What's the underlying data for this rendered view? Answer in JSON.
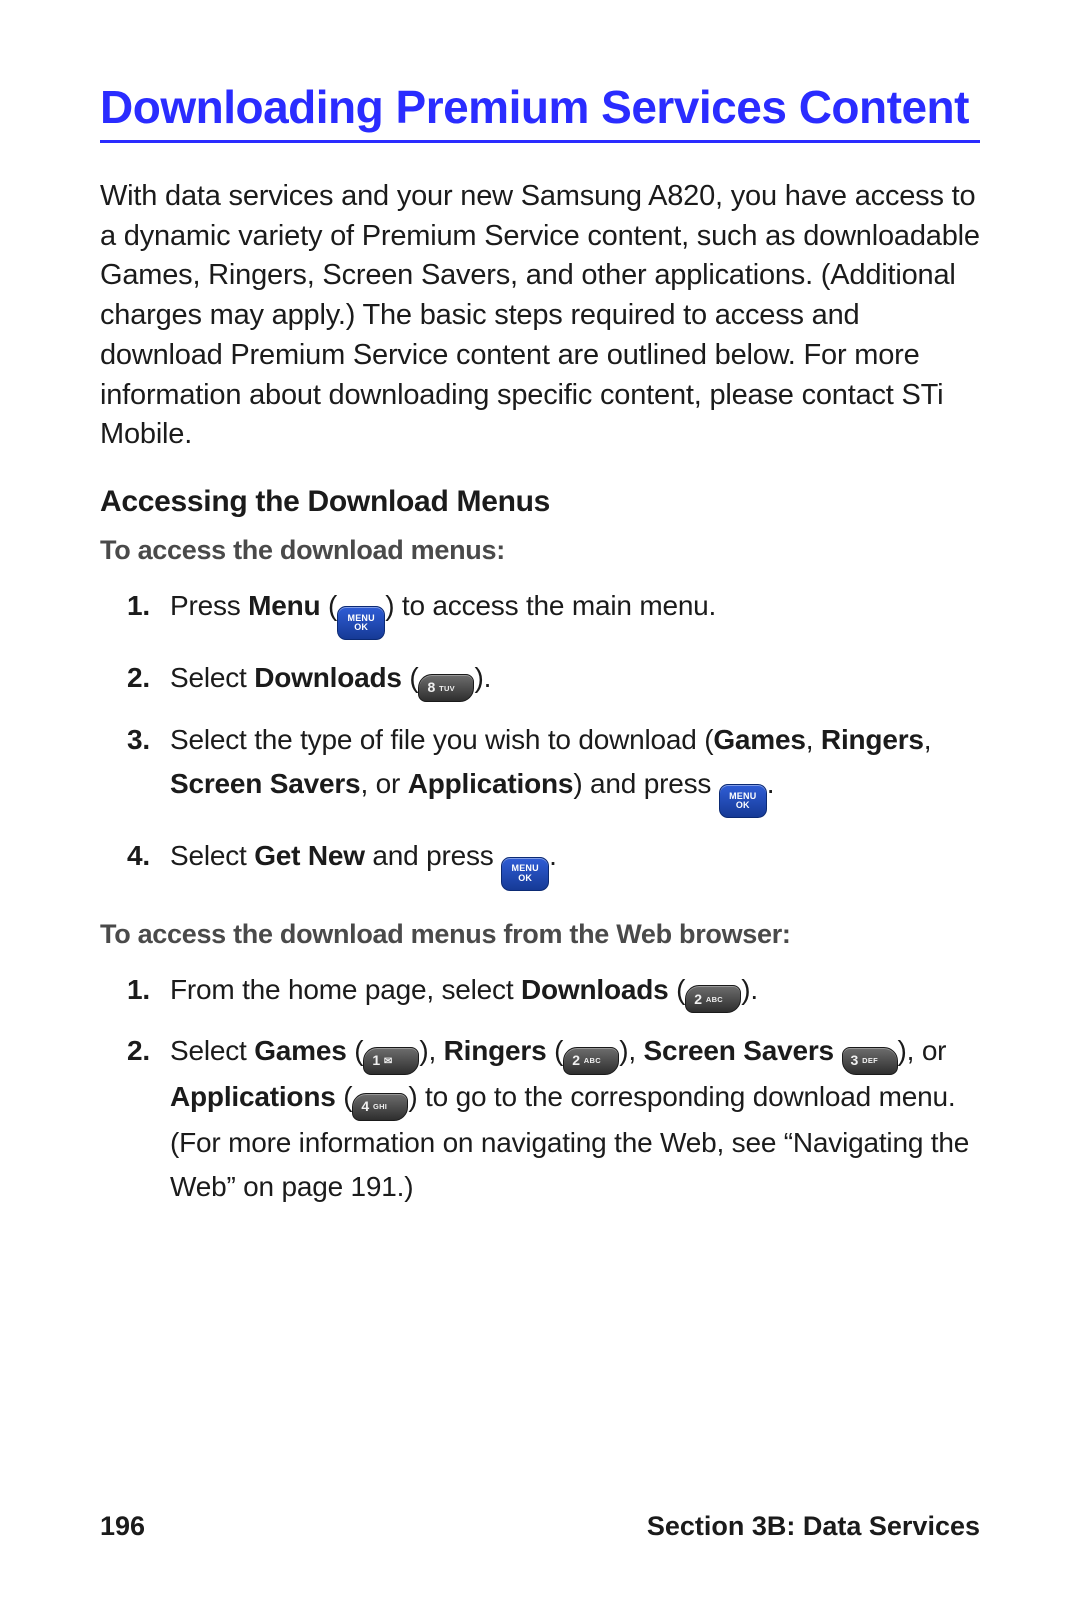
{
  "title": "Downloading Premium Services Content",
  "intro": "With data services and your new Samsung A820, you have access to a dynamic variety of Premium Service content, such as downloadable Games, Ringers, Screen Savers, and other applications. (Additional charges may apply.) The basic steps required to access and download Premium Service content are outlined below. For more information about downloading specific content, please contact STi Mobile.",
  "subhead": "Accessing the Download Menus",
  "instr1": "To access the download menus:",
  "steps1": {
    "n1": "1.",
    "s1a": "Press ",
    "s1b": "Menu",
    "s1c": " (",
    "s1d": ") to access the main menu.",
    "n2": "2.",
    "s2a": "Select ",
    "s2b": "Downloads",
    "s2c": " (",
    "s2d": ").",
    "n3": "3.",
    "s3a": "Select the type of file you wish to download (",
    "s3b": "Games",
    "s3c": ", ",
    "s3d": "Ringers",
    "s3e": ", ",
    "s3f": "Screen Savers",
    "s3g": ", or ",
    "s3h": "Applications",
    "s3i": ") and press ",
    "s3j": ".",
    "n4": "4.",
    "s4a": "Select ",
    "s4b": "Get New",
    "s4c": " and press ",
    "s4d": "."
  },
  "instr2": "To access the download menus from the Web browser:",
  "steps2": {
    "n1": "1.",
    "s1a": "From the home page, select ",
    "s1b": "Downloads",
    "s1c": " (",
    "s1d": ").",
    "n2": "2.",
    "s2a": "Select ",
    "s2b": "Games",
    "s2c": " (",
    "s2d": "), ",
    "s2e": "Ringers",
    "s2f": " (",
    "s2g": "), ",
    "s2h": "Screen Savers",
    "s2i": "  ",
    "s2j": "), or ",
    "s2k": "Applications",
    "s2l": " (",
    "s2m": ") to go to the corresponding download menu. (For more information on navigating the Web, see “Navigating the Web” on page 191.)"
  },
  "keys": {
    "menu_top": "MENU",
    "menu_bot": "OK",
    "k1d": "1",
    "k1s": "",
    "k2d": "2",
    "k2s": "ABC",
    "k3d": "3",
    "k3s": "DEF",
    "k4d": "4",
    "k4s": "GHI",
    "k8d": "8",
    "k8s": "TUV"
  },
  "footer": {
    "page": "196",
    "section": "Section 3B: Data Services"
  }
}
